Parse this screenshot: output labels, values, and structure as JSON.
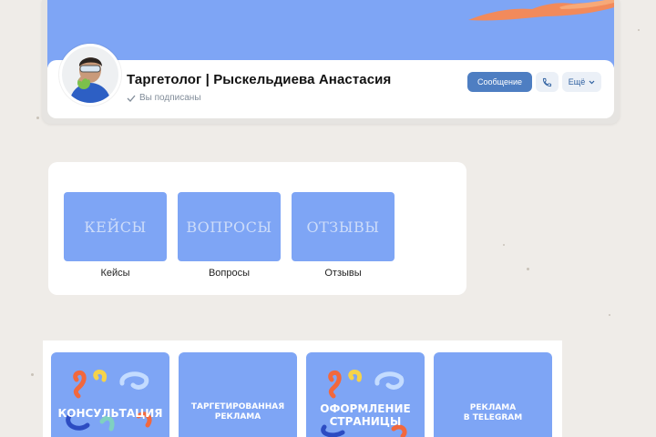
{
  "profile": {
    "name": "Таргетолог | Рыскельдиева Анастасия",
    "status": "Вы подписаны",
    "actions": {
      "message": "Сообщение",
      "more": "Ещё"
    }
  },
  "menu": {
    "items": [
      {
        "tile": "КЕЙСЫ",
        "label": "Кейсы"
      },
      {
        "tile": "ВОПРОСЫ",
        "label": "Вопросы"
      },
      {
        "tile": "ОТЗЫВЫ",
        "label": "Отзывы"
      }
    ]
  },
  "products": [
    {
      "line1": "КОНСУЛЬТАЦИЯ",
      "line2": ""
    },
    {
      "line1": "ТАРГЕТИРОВАННАЯ",
      "line2": "РЕКЛАМА"
    },
    {
      "line1": "ОФОРМЛЕНИЕ",
      "line2": "СТРАНИЦЫ"
    },
    {
      "line1": "РЕКЛАМА",
      "line2": "В TELEGRAM"
    }
  ],
  "colors": {
    "accent": "#7ea5f5",
    "primary_button": "#4e7ec2",
    "background": "#efece8"
  }
}
